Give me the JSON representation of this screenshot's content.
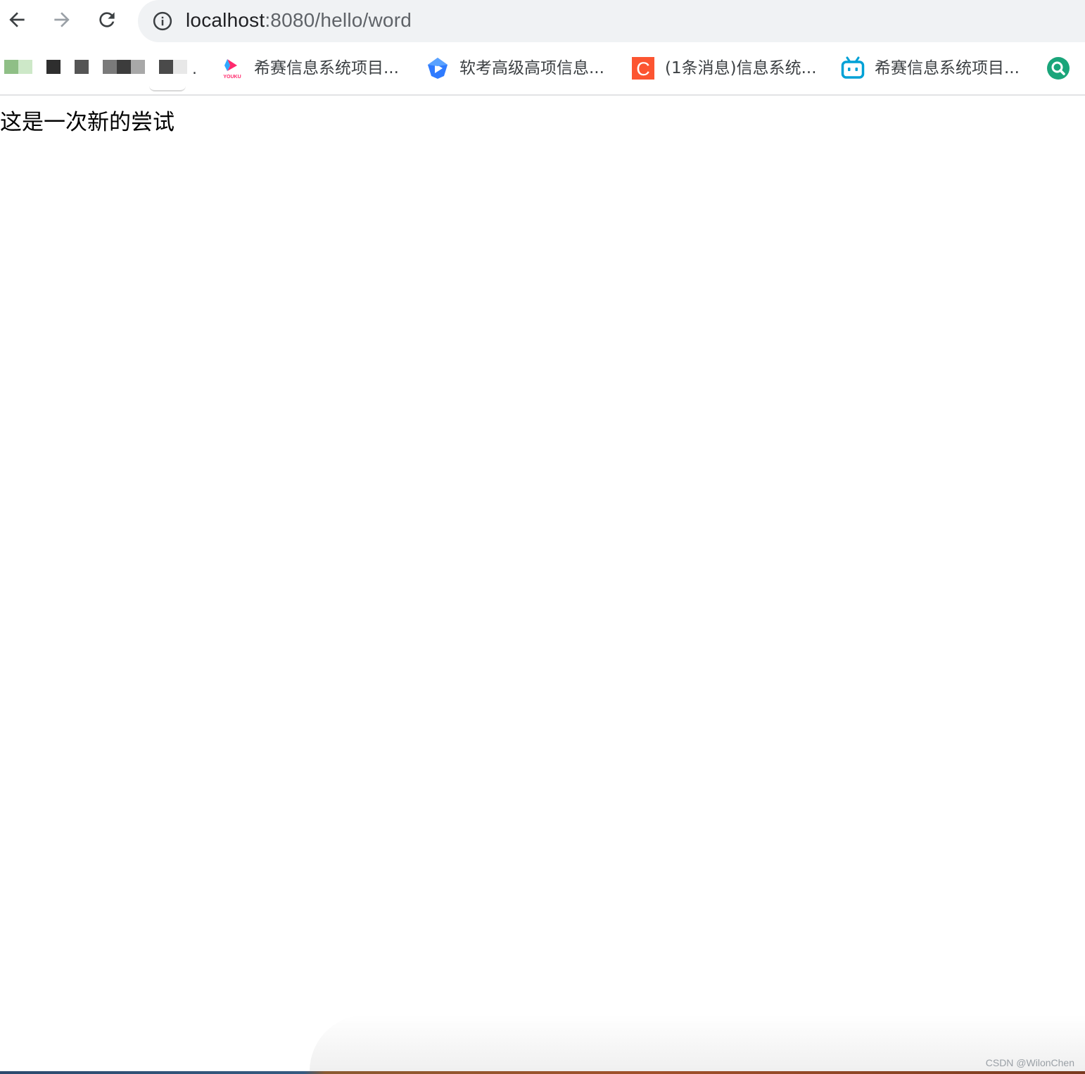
{
  "address_bar": {
    "url_host": "localhost",
    "url_path": ":8080/hello/word"
  },
  "bookmarks": [
    {
      "label": "希赛信息系统项目...",
      "icon": "youku-icon"
    },
    {
      "label": "软考高级高项信息...",
      "icon": "blue-play-icon"
    },
    {
      "label": "(1条消息)信息系统...",
      "icon": "csdn-icon"
    },
    {
      "label": "希赛信息系统项目...",
      "icon": "bilibili-icon"
    },
    {
      "label": "",
      "icon": "green-search-icon"
    }
  ],
  "bookmarks_overflow_text": ".",
  "bookmark_icons": {
    "youku_text": "YOUKU",
    "csdn_letter": "C"
  },
  "page": {
    "text": "这是一次新的尝试"
  },
  "watermark": "CSDN @WilonChen",
  "colors": {
    "omnibox_bg": "#f0f2f4",
    "csdn_orange": "#fc5531",
    "bilibili_blue": "#00a1d6",
    "search_green": "#1aa57a",
    "youku_pink": "#ff2a6d"
  }
}
